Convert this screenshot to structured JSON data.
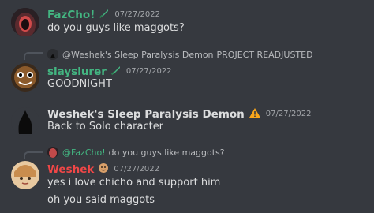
{
  "messages": [
    {
      "author": "FazCho!",
      "author_color": "#43b581",
      "author_icon": "green-sword-icon",
      "timestamp": "07/27/2022",
      "lines": [
        "do you guys like maggots?"
      ]
    },
    {
      "reply_preview": {
        "name": "@Weshek's Sleep Paralysis Demon",
        "text": "PROJECT READJUSTED"
      },
      "author": "slayslurer",
      "author_color": "#43b581",
      "author_icon": "green-sword-icon",
      "timestamp": "07/27/2022",
      "lines": [
        "GOODNIGHT"
      ]
    },
    {
      "author": "Weshek's Sleep Paralysis Demon",
      "author_color": "#dcddde",
      "author_icon": "warning-icon",
      "timestamp": "07/27/2022",
      "lines": [
        "Back to Solo character"
      ]
    },
    {
      "reply_preview": {
        "name": "@FazCho!",
        "text": "do you guys like maggots?"
      },
      "author": "Weshek",
      "author_color": "#f04747",
      "author_icon": "face-emoji-icon",
      "timestamp": "07/27/2022",
      "lines": [
        "yes i love chicho and support him",
        "oh you said maggots"
      ]
    }
  ]
}
